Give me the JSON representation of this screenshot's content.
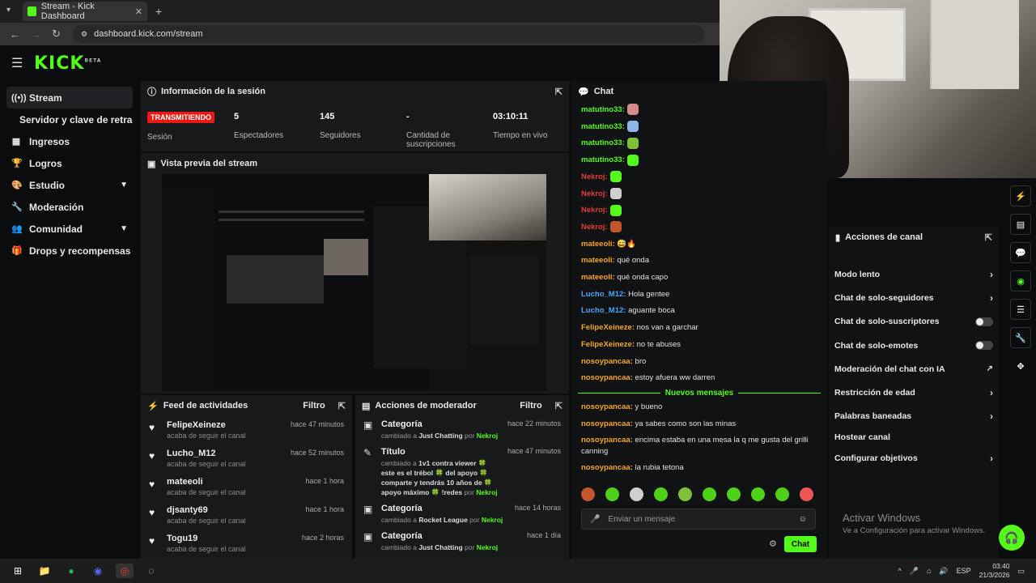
{
  "browser": {
    "tab_title": "Stream - Kick Dashboard",
    "tab_close": "✕",
    "new_tab": "+",
    "url": "dashboard.kick.com/stream"
  },
  "brand": {
    "logo": "KICK",
    "logo_sup": "BETA",
    "accent": "#53fc18"
  },
  "sidebar": {
    "items": [
      {
        "label": "Stream",
        "icon": "broadcast-icon"
      },
      {
        "label": "Servidor y clave de retransmisión",
        "icon": ""
      },
      {
        "label": "Ingresos",
        "icon": "chart-icon"
      },
      {
        "label": "Logros",
        "icon": "trophy-icon"
      },
      {
        "label": "Estudio",
        "icon": "palette-icon"
      },
      {
        "label": "Moderación",
        "icon": "wrench-icon"
      },
      {
        "label": "Comunidad",
        "icon": "people-icon"
      },
      {
        "label": "Drops y recompensas",
        "icon": "gift-icon"
      }
    ]
  },
  "session": {
    "title": "Información de la sesión",
    "status": "TRANSMITIENDO",
    "status_label": "Sesión",
    "viewers": "5",
    "viewers_label": "Espectadores",
    "followers": "145",
    "followers_label": "Seguidores",
    "subs": "-",
    "subs_label": "Cantidad de suscripciones",
    "uptime": "03:10:11",
    "uptime_label": "Tiempo en vivo"
  },
  "preview": {
    "title": "Vista previa del stream"
  },
  "feed": {
    "title": "Feed de actividades",
    "filter": "Filtro",
    "items": [
      {
        "name": "FelipeXeineze",
        "sub": "acaba de seguir el canal",
        "time": "hace 47 minutos"
      },
      {
        "name": "Lucho_M12",
        "sub": "acaba de seguir el canal",
        "time": "hace 52 minutos"
      },
      {
        "name": "mateeoli",
        "sub": "acaba de seguir el canal",
        "time": "hace 1 hora"
      },
      {
        "name": "djsanty69",
        "sub": "acaba de seguir el canal",
        "time": "hace 1 hora"
      },
      {
        "name": "Togu19",
        "sub": "acaba de seguir el canal",
        "time": "hace 2 horas"
      }
    ]
  },
  "mod": {
    "title": "Acciones de moderador",
    "filter": "Filtro",
    "items": [
      {
        "name": "Categoría",
        "pre": "cambiado a",
        "value": "Just Chatting",
        "by": "por",
        "user": "Nekroj",
        "time": "hace 22 minutos"
      },
      {
        "name": "Título",
        "pre": "cambiado a",
        "value": "1v1 contra viewer 🍀 este es el trébol 🍀 del apoyo 🍀 comparte y tendrás 10 años de 🍀 apoyo máximo 🍀 !redes",
        "by": "por",
        "user": "Nekroj",
        "time": "hace 47 minutos"
      },
      {
        "name": "Categoría",
        "pre": "cambiado a",
        "value": "Rocket League",
        "by": "por",
        "user": "Nekroj",
        "time": "hace 14 horas"
      },
      {
        "name": "Categoría",
        "pre": "cambiado a",
        "value": "Just Chatting",
        "by": "por",
        "user": "Nekroj",
        "time": "hace 1 día"
      }
    ]
  },
  "chat": {
    "title": "Chat",
    "messages": [
      {
        "user": "matutino33:",
        "text": "",
        "color": "#53fc18",
        "emote": "#d88a8a"
      },
      {
        "user": "matutino33:",
        "text": "",
        "color": "#53fc18",
        "emote": "#8fb4e6"
      },
      {
        "user": "matutino33:",
        "text": "",
        "color": "#53fc18",
        "emote": "#7fbf3a"
      },
      {
        "user": "matutino33:",
        "text": "",
        "color": "#53fc18",
        "emote": "#53fc18"
      },
      {
        "user": "Nekroj:",
        "text": "",
        "color": "#e53935",
        "emote": "#53fc18"
      },
      {
        "user": "Nekroj:",
        "text": "",
        "color": "#e53935",
        "emote": "#cfcfcf"
      },
      {
        "user": "Nekroj:",
        "text": "",
        "color": "#e53935",
        "emote": "#53fc18"
      },
      {
        "user": "Nekroj:",
        "text": "",
        "color": "#e53935",
        "emote": "#c2572f"
      },
      {
        "user": "mateeoli:",
        "text": "😅🔥",
        "color": "#f5a623",
        "emote": ""
      },
      {
        "user": "mateeoli:",
        "text": "qué onda",
        "color": "#f5a623",
        "emote": ""
      },
      {
        "user": "mateeoli:",
        "text": "qué onda capo",
        "color": "#f5a623",
        "emote": ""
      },
      {
        "user": "Lucho_M12:",
        "text": "Hola gentee",
        "color": "#4aa3ff",
        "emote": ""
      },
      {
        "user": "Lucho_M12:",
        "text": "aguante boca",
        "color": "#4aa3ff",
        "emote": ""
      },
      {
        "user": "FelipeXeineze:",
        "text": "nos van a garchar",
        "color": "#f5a623",
        "emote": ""
      },
      {
        "user": "FelipeXeineze:",
        "text": "no te abuses",
        "color": "#f5a623",
        "emote": ""
      },
      {
        "user": "nosoypancaa:",
        "text": "bro",
        "color": "#f5a623",
        "emote": ""
      },
      {
        "user": "nosoypancaa:",
        "text": "estoy afuera ww darren",
        "color": "#f5a623",
        "emote": ""
      }
    ],
    "new_messages": "Nuevos mensajes",
    "new": [
      {
        "user": "nosoypancaa:",
        "text": "y bueno",
        "color": "#f5a623"
      },
      {
        "user": "nosoypancaa:",
        "text": "ya sabes como son las minas",
        "color": "#f5a623"
      },
      {
        "user": "nosoypancaa:",
        "text": "encima estaba en una mesa la q me gusta del grilli canning",
        "color": "#f5a623"
      },
      {
        "user": "nosoypancaa:",
        "text": "la rubia tetona",
        "color": "#f5a623"
      }
    ],
    "placeholder": "Enviar un mensaje",
    "send": "Chat"
  },
  "actions": {
    "title": "Acciones de canal",
    "items": [
      {
        "label": "Modo lento",
        "kind": "arrow"
      },
      {
        "label": "Chat de solo-seguidores",
        "kind": "arrow"
      },
      {
        "label": "Chat de solo-suscriptores",
        "kind": "toggle",
        "on": false
      },
      {
        "label": "Chat de solo-emotes",
        "kind": "toggle",
        "on": false
      },
      {
        "label": "Moderación del chat con IA",
        "kind": "external"
      },
      {
        "label": "Restricción de edad",
        "kind": "arrow"
      },
      {
        "label": "Palabras baneadas",
        "kind": "arrow"
      },
      {
        "label": "Hostear canal",
        "kind": "none"
      },
      {
        "label": "Configurar objetivos",
        "kind": "arrow"
      }
    ]
  },
  "windows": {
    "activate_title": "Activar Windows",
    "activate_sub": "Ve a Configuración para activar Windows."
  },
  "taskbar": {
    "lang": "ESP",
    "time": "03:40",
    "date": "21/3/2026"
  }
}
